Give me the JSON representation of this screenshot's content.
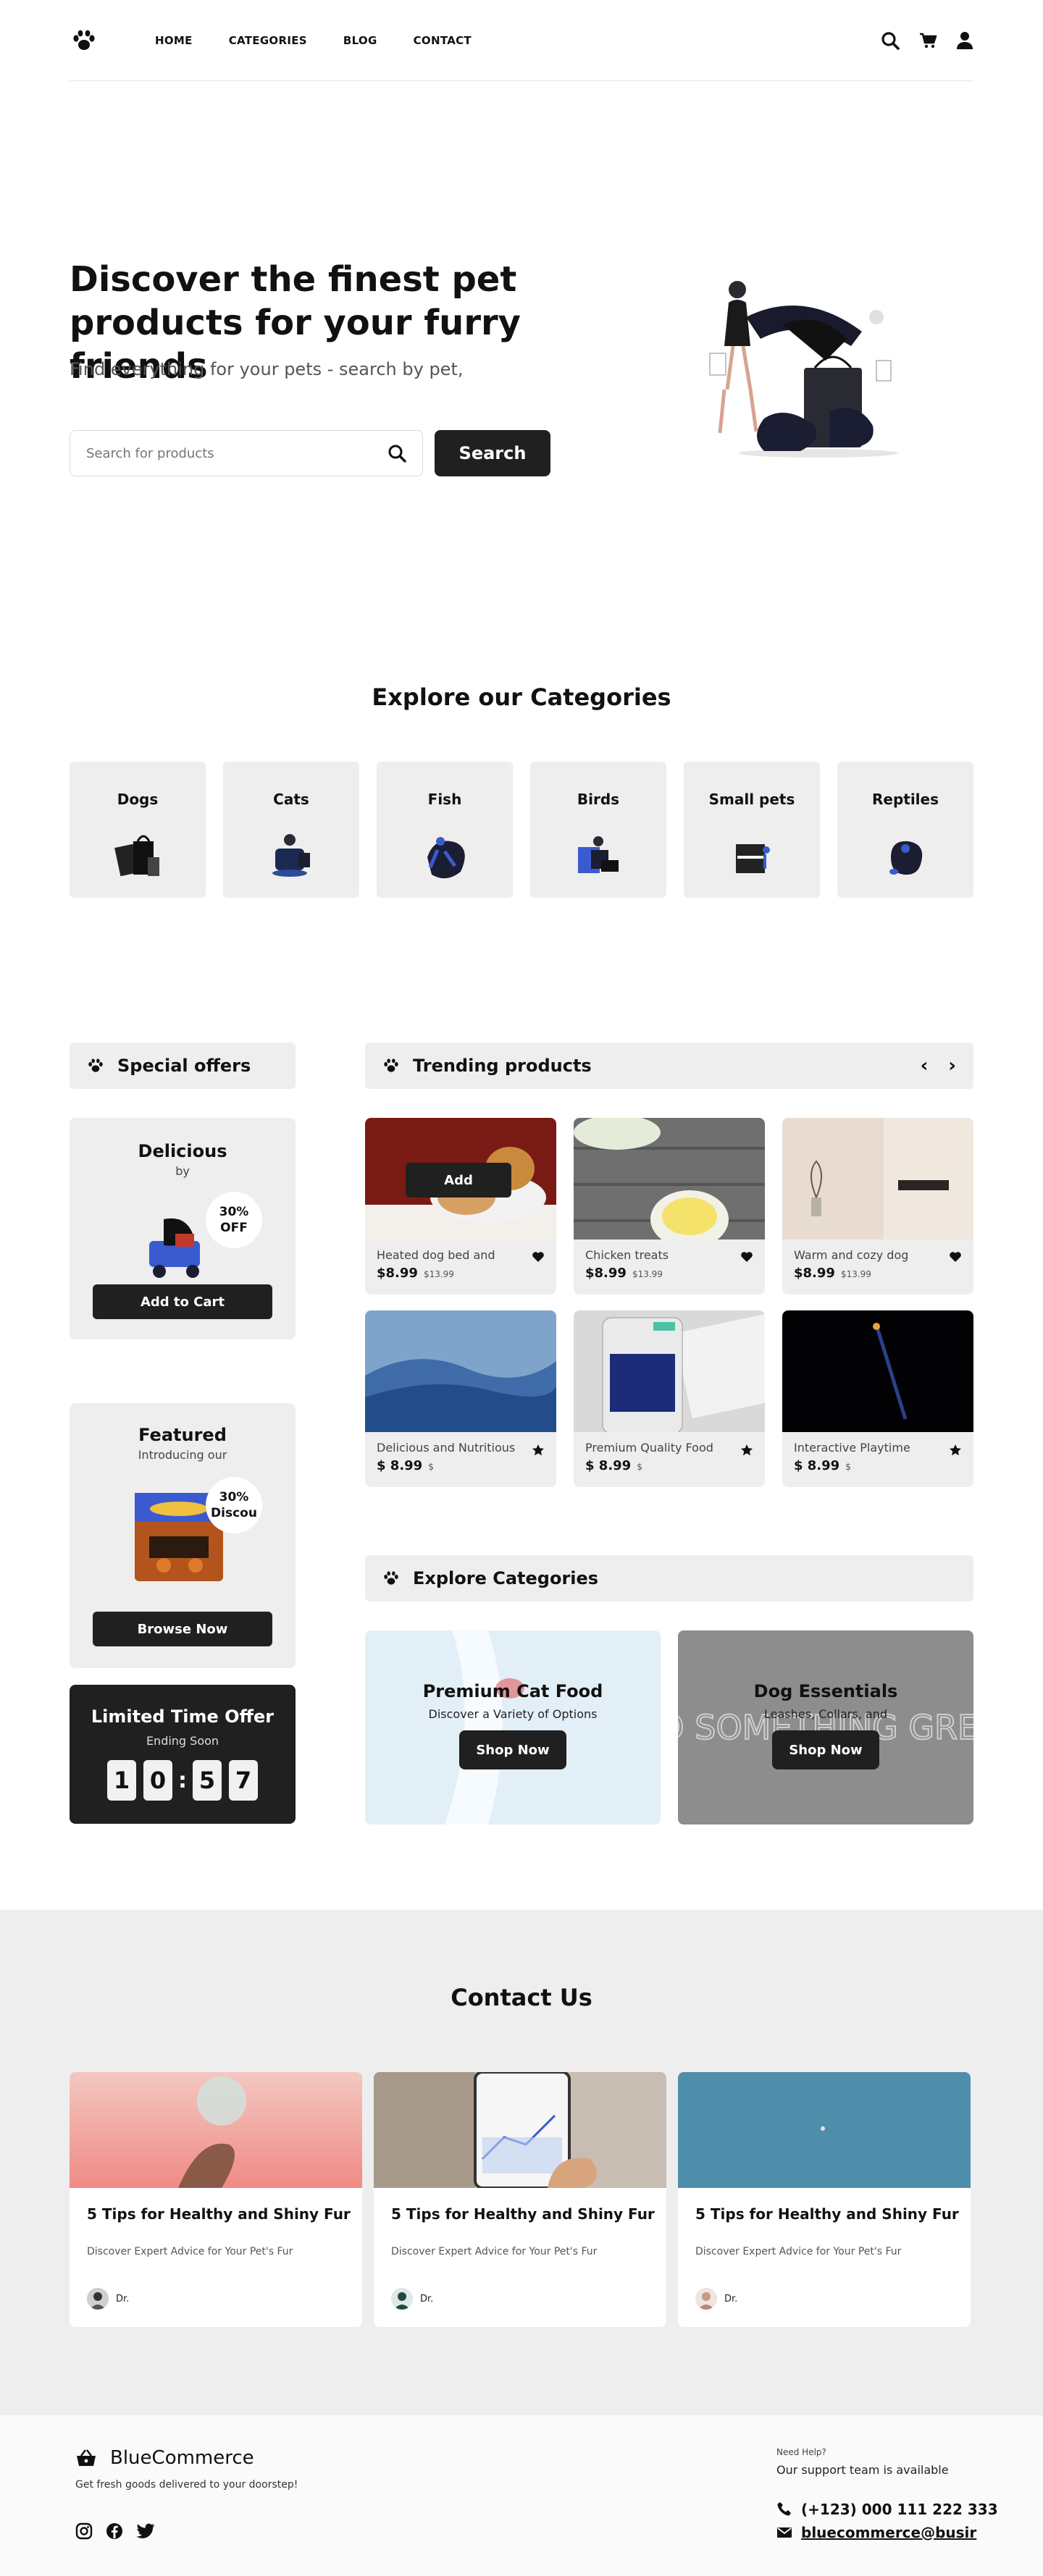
{
  "nav": {
    "links": [
      "HOME",
      "CATEGORIES",
      "BLOG",
      "CONTACT"
    ]
  },
  "hero": {
    "title_line1": "Discover the finest pet",
    "title_line2": "products for your furry friends",
    "subtitle": "Find everything for your pets - search by pet,",
    "search_placeholder": "Search for products",
    "search_button": "Search"
  },
  "categories": {
    "title": "Explore our Categories",
    "items": [
      {
        "label": "Dogs",
        "icon": "shopping-bags-illustration"
      },
      {
        "label": "Cats",
        "icon": "shopper-illustration"
      },
      {
        "label": "Fish",
        "icon": "runner-illustration"
      },
      {
        "label": "Birds",
        "icon": "laptop-person-illustration"
      },
      {
        "label": "Small pets",
        "icon": "box-person-illustration"
      },
      {
        "label": "Reptiles",
        "icon": "plant-person-illustration"
      }
    ]
  },
  "special_offers": {
    "heading": "Special offers",
    "offer1": {
      "title": "Delicious",
      "subtitle": "by",
      "discount_line1": "30%",
      "discount_line2": "OFF",
      "button": "Add to Cart"
    },
    "offer2": {
      "title": "Featured",
      "subtitle": "Introducing our",
      "discount_line1": "30%",
      "discount_line2": "Discou",
      "button": "Browse Now"
    },
    "timer": {
      "title": "Limited Time Offer",
      "subtitle": "Ending Soon",
      "digits": [
        "1",
        "0",
        "5",
        "7"
      ],
      "separator": ":"
    }
  },
  "trending": {
    "heading": "Trending products",
    "prev": "‹",
    "next": "›",
    "add_label": "Add",
    "products": [
      {
        "name": "Heated dog bed and",
        "price": "$8.99",
        "old_price": "$13.99",
        "icon": "heart-icon"
      },
      {
        "name": "Chicken treats",
        "price": "$8.99",
        "old_price": "$13.99",
        "icon": "heart-icon"
      },
      {
        "name": "Warm and cozy dog",
        "price": "$8.99",
        "old_price": "$13.99",
        "icon": "heart-icon"
      },
      {
        "name": "Delicious and Nutritious",
        "price": "$ 8.99",
        "old_price": "$",
        "icon": "star-icon"
      },
      {
        "name": "Premium Quality Food",
        "price": "$ 8.99",
        "old_price": "$",
        "icon": "star-icon"
      },
      {
        "name": "Interactive Playtime",
        "price": "$ 8.99",
        "old_price": "$",
        "icon": "star-icon"
      }
    ]
  },
  "explore": {
    "heading": "Explore Categories",
    "banners": [
      {
        "title": "Premium Cat Food",
        "subtitle": "Discover a Variety of Options",
        "button": "Shop Now"
      },
      {
        "title": "Dog Essentials",
        "subtitle": "Leashes, Collars, and",
        "button": "Shop Now",
        "sign_text": "DO SOMETHING GREAT"
      }
    ]
  },
  "contact": {
    "title": "Contact Us",
    "posts": [
      {
        "title": "5 Tips for Healthy and Shiny Fur",
        "desc": "Discover Expert Advice for Your Pet's Fur",
        "author": "Dr."
      },
      {
        "title": "5 Tips for Healthy and Shiny Fur",
        "desc": "Discover Expert Advice for Your Pet's Fur",
        "author": "Dr."
      },
      {
        "title": "5 Tips for Healthy and Shiny Fur",
        "desc": "Discover Expert Advice for Your Pet's Fur",
        "author": "Dr."
      }
    ]
  },
  "footer": {
    "brand": "BlueCommerce",
    "tagline": "Get fresh goods delivered to your doorstep!",
    "help": "Need Help?",
    "support": "Our support team is available",
    "phone": "(+123) 000 111 222 333",
    "email": "bluecommerce@busir"
  },
  "colors": {
    "dark": "#202020",
    "card": "#eeeeee",
    "section": "#eeeeee"
  }
}
